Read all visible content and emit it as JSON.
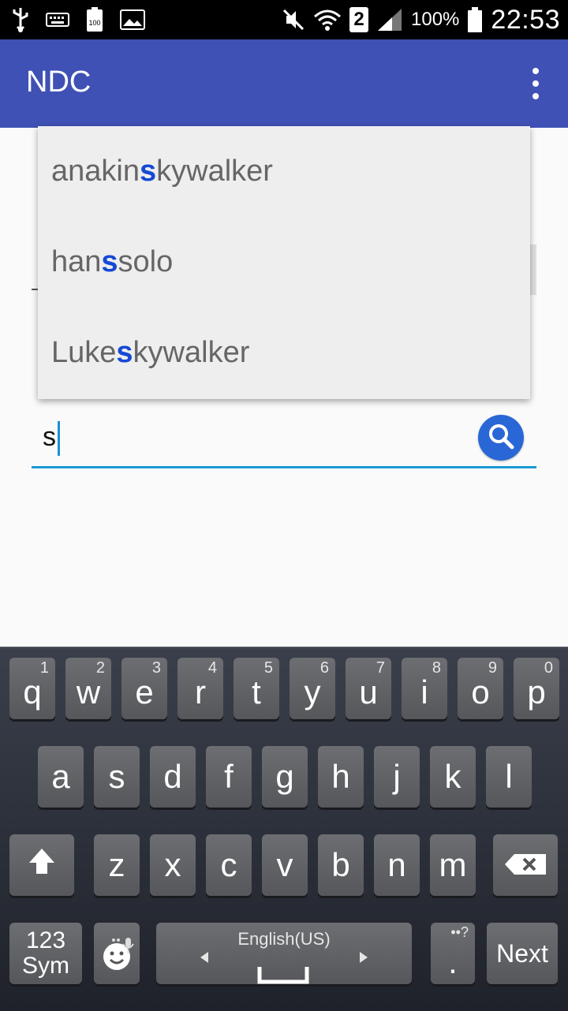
{
  "status_bar": {
    "battery_percent": "100%",
    "time": "22:53",
    "sim_slot": "2",
    "icons": [
      "usb-icon",
      "keyboard-icon",
      "battery-100-icon",
      "image-icon",
      "mute-icon",
      "wifi-icon",
      "signal-icon",
      "battery-icon"
    ]
  },
  "app_bar": {
    "title": "NDC",
    "menu_icon": "more-vert-icon"
  },
  "search": {
    "value": "s",
    "button_icon": "search-icon"
  },
  "suggestions": [
    {
      "before": "anakin ",
      "match": "s",
      "after": "kywalker"
    },
    {
      "before": "han",
      "match": "s",
      "after": " solo"
    },
    {
      "before": "Luke ",
      "match": "s",
      "after": "kywalker"
    }
  ],
  "keyboard": {
    "row1": [
      {
        "l": "q",
        "s": "1"
      },
      {
        "l": "w",
        "s": "2"
      },
      {
        "l": "e",
        "s": "3"
      },
      {
        "l": "r",
        "s": "4"
      },
      {
        "l": "t",
        "s": "5"
      },
      {
        "l": "y",
        "s": "6"
      },
      {
        "l": "u",
        "s": "7"
      },
      {
        "l": "i",
        "s": "8"
      },
      {
        "l": "o",
        "s": "9"
      },
      {
        "l": "p",
        "s": "0"
      }
    ],
    "row2": [
      "a",
      "s",
      "d",
      "f",
      "g",
      "h",
      "j",
      "k",
      "l"
    ],
    "row3": [
      "z",
      "x",
      "c",
      "v",
      "b",
      "n",
      "m"
    ],
    "sym_label_1": "123",
    "sym_label_2": "Sym",
    "space_label": "English(US)",
    "period_label": ".",
    "period_sup": "••?",
    "next_label": "Next",
    "colors": {
      "accent": "#3f51b5",
      "highlight": "#1549d6",
      "underline": "#1a9ad6"
    }
  }
}
